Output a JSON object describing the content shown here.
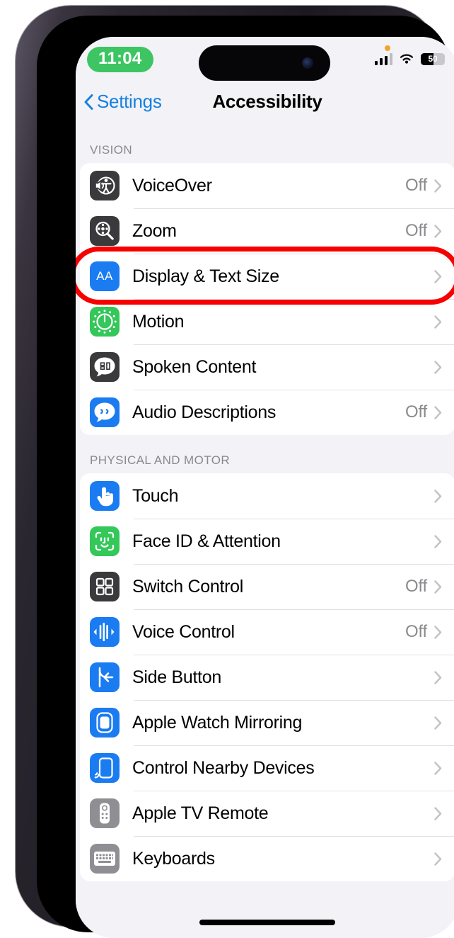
{
  "status_bar": {
    "time": "11:04",
    "battery_percent": "50",
    "signal_icon": "cellular-bars-icon",
    "wifi_icon": "wifi-icon",
    "battery_icon": "battery-icon",
    "privacy_dot_icon": "orange-privacy-dot-icon",
    "dynamic_island_icon": "dynamic-island"
  },
  "nav": {
    "back_label": "Settings",
    "back_icon": "chevron-left-icon",
    "title": "Accessibility"
  },
  "colors": {
    "accent_blue": "#1580e0",
    "highlight_red": "#f70000",
    "icon_blue": "#1a7cf0",
    "icon_green": "#34c759",
    "icon_dark": "#3a3a3c",
    "icon_gray": "#8e8e93",
    "screen_bg": "#f2f2f7",
    "row_bg": "#ffffff",
    "time_pill_green": "#3cc562"
  },
  "sections": [
    {
      "header": "VISION",
      "rows": [
        {
          "label": "VoiceOver",
          "value": "Off",
          "icon": "voiceover-icon",
          "icon_style": "dark"
        },
        {
          "label": "Zoom",
          "value": "Off",
          "icon": "zoom-magnifier-icon",
          "icon_style": "dark"
        },
        {
          "label": "Display & Text Size",
          "value": "",
          "icon": "display-text-size-icon",
          "icon_style": "blue",
          "highlighted": true
        },
        {
          "label": "Motion",
          "value": "",
          "icon": "motion-icon",
          "icon_style": "green"
        },
        {
          "label": "Spoken Content",
          "value": "",
          "icon": "spoken-content-icon",
          "icon_style": "dark"
        },
        {
          "label": "Audio Descriptions",
          "value": "Off",
          "icon": "audio-descriptions-icon",
          "icon_style": "blue"
        }
      ]
    },
    {
      "header": "PHYSICAL AND MOTOR",
      "rows": [
        {
          "label": "Touch",
          "value": "",
          "icon": "touch-icon",
          "icon_style": "blue"
        },
        {
          "label": "Face ID & Attention",
          "value": "",
          "icon": "face-id-icon",
          "icon_style": "green"
        },
        {
          "label": "Switch Control",
          "value": "Off",
          "icon": "switch-control-icon",
          "icon_style": "dark"
        },
        {
          "label": "Voice Control",
          "value": "Off",
          "icon": "voice-control-icon",
          "icon_style": "blue"
        },
        {
          "label": "Side Button",
          "value": "",
          "icon": "side-button-icon",
          "icon_style": "blue"
        },
        {
          "label": "Apple Watch Mirroring",
          "value": "",
          "icon": "apple-watch-mirroring-icon",
          "icon_style": "blue"
        },
        {
          "label": "Control Nearby Devices",
          "value": "",
          "icon": "control-nearby-devices-icon",
          "icon_style": "blue"
        },
        {
          "label": "Apple TV Remote",
          "value": "",
          "icon": "apple-tv-remote-icon",
          "icon_style": "gray"
        },
        {
          "label": "Keyboards",
          "value": "",
          "icon": "keyboards-icon",
          "icon_style": "gray"
        }
      ]
    }
  ]
}
